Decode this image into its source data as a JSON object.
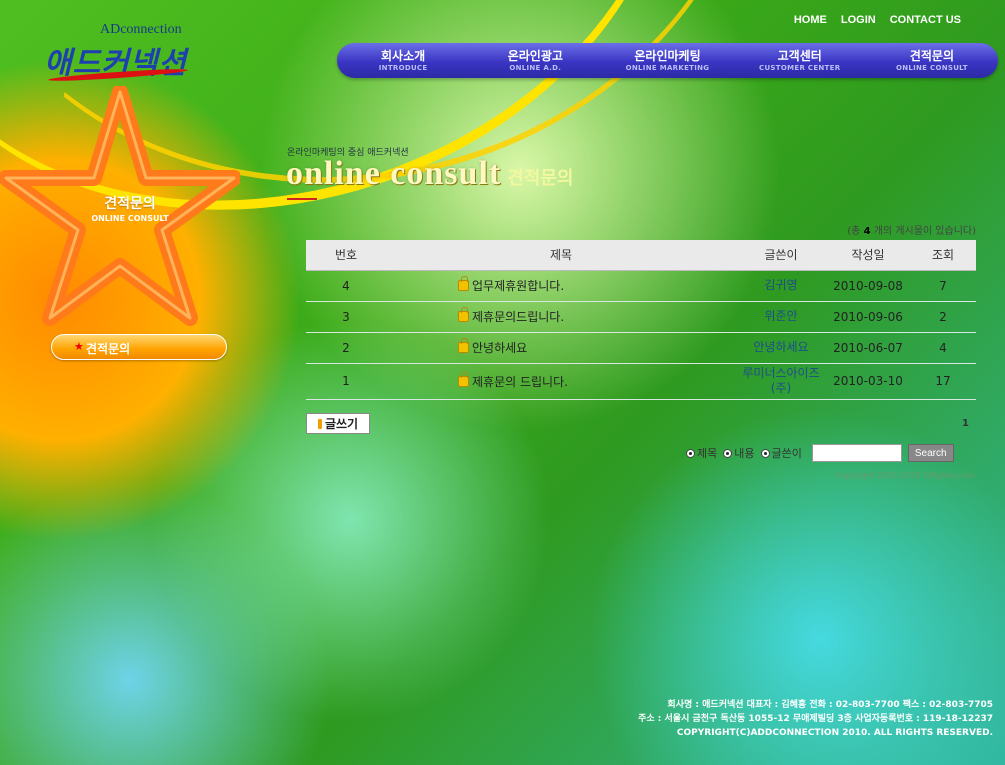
{
  "logo": {
    "en": "ADconnection",
    "ko": "애드커넥션"
  },
  "top_links": [
    "HOME",
    "LOGIN",
    "CONTACT US"
  ],
  "gnb": [
    {
      "ko": "회사소개",
      "en": "INTRODUCE"
    },
    {
      "ko": "온라인광고",
      "en": "ONLINE A.D."
    },
    {
      "ko": "온라인마케팅",
      "en": "ONLINE MARKETING"
    },
    {
      "ko": "고객센터",
      "en": "CUSTOMER CENTER"
    },
    {
      "ko": "견적문의",
      "en": "ONLINE CONSULT"
    }
  ],
  "side": {
    "title": "견적문의",
    "subtitle": "ONLINE CONSULT",
    "menu_item": "견적문의"
  },
  "page": {
    "kicker": "온라인마케팅의 중심 애드커넥션",
    "title_en": "online consult",
    "title_ko": "견적문의"
  },
  "board": {
    "count_prefix": "(총",
    "count": "4",
    "count_suffix": "개의 게시물이 있습니다)",
    "headers": [
      "번호",
      "제목",
      "글쓴이",
      "작성일",
      "조회"
    ],
    "rows": [
      {
        "no": "4",
        "subject": "업무제휴원합니다.",
        "writer": "김귀영",
        "date": "2010-09-08",
        "views": "7"
      },
      {
        "no": "3",
        "subject": "제휴문의드립니다.",
        "writer": "위준안",
        "date": "2010-09-06",
        "views": "2"
      },
      {
        "no": "2",
        "subject": "안녕하세요",
        "writer": "안녕하세요",
        "date": "2010-06-07",
        "views": "4"
      },
      {
        "no": "1",
        "subject": "제휴문의 드립니다.",
        "writer": "루미너스아이즈(주)",
        "date": "2010-03-10",
        "views": "17"
      }
    ],
    "write_label": "글쓰기",
    "page_number": "1"
  },
  "search": {
    "options": [
      "제목",
      "내용",
      "글쓴이"
    ],
    "input_value": "",
    "button_label": "Search",
    "copyright_small": "Copyright 2003-2010 GMglory.com"
  },
  "footer": {
    "line1": "회사명 : 애드커넥션    대표자 : 김혜흥    전화 : 02-803-7700    팩스 : 02-803-7705",
    "line2": "주소 : 서울시 금천구 독산동 1055-12 무애제빌딩 3층    사업자등록번호 : 119-18-12237",
    "line3": "COPYRIGHT(C)ADDCONNECTION 2010. ALL RIGHTS RESERVED."
  },
  "colors": {
    "gnb": "#3a35c2",
    "star": "#ff8a1a",
    "accent": "#ffe400"
  }
}
